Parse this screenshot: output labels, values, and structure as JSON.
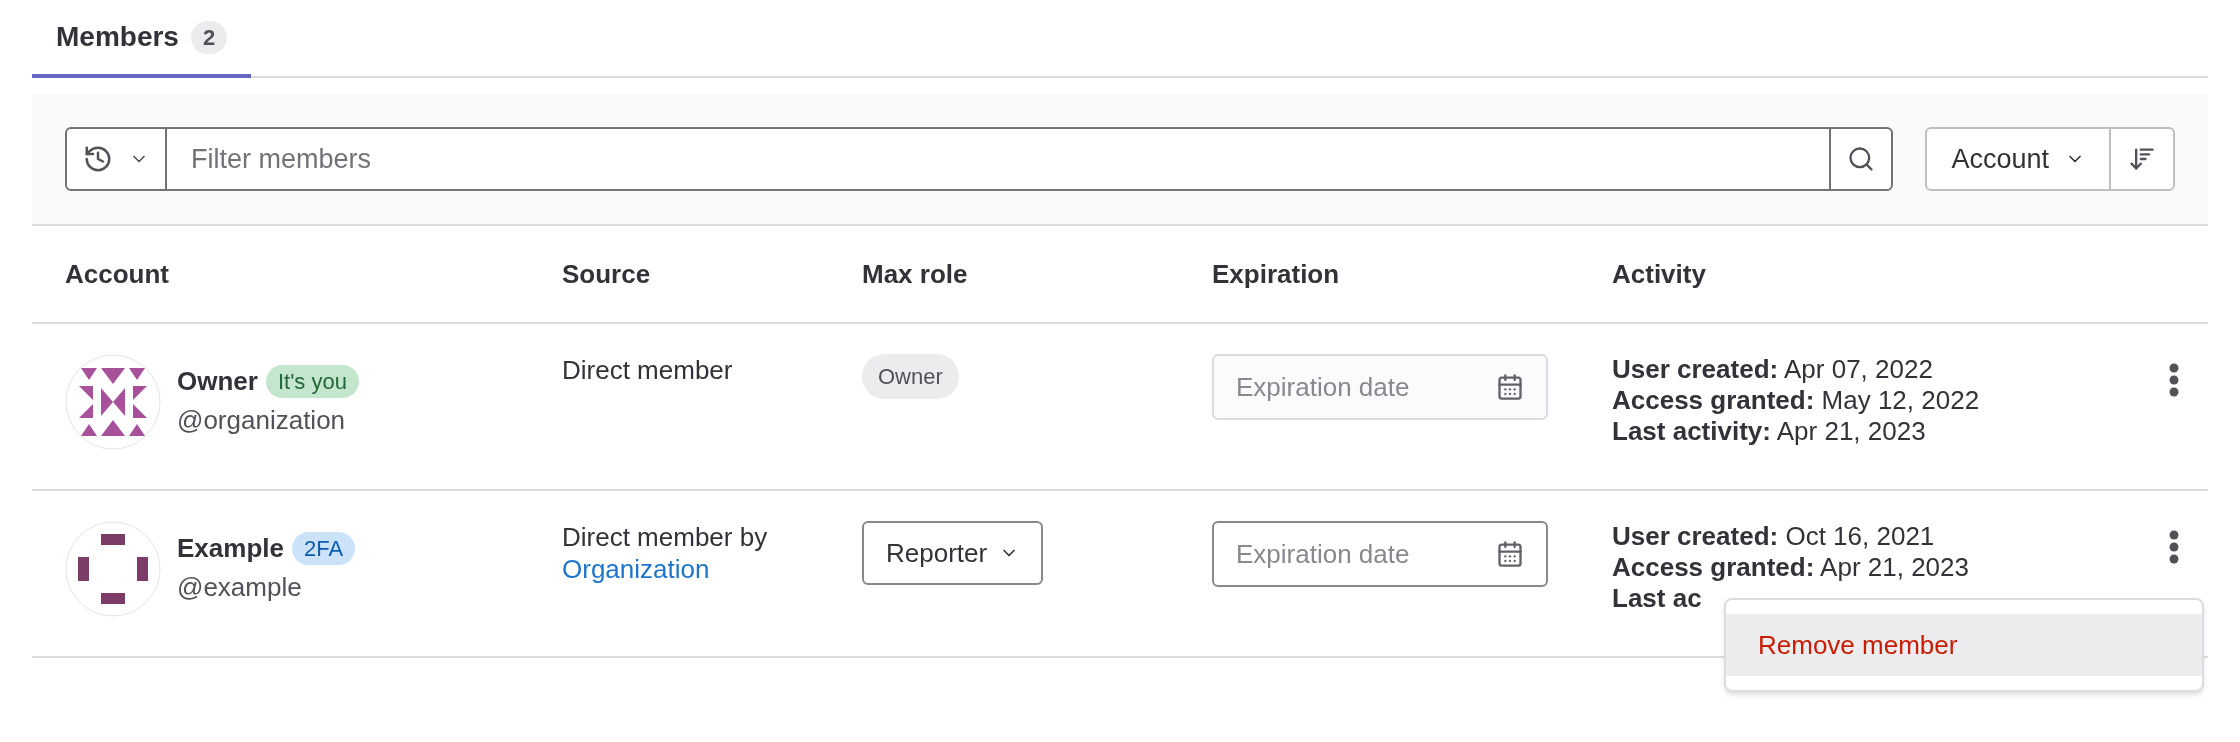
{
  "tabs": [
    {
      "label": "Members",
      "count": "2",
      "selected": true
    }
  ],
  "filter": {
    "placeholder": "Filter members"
  },
  "sort": {
    "label": "Account"
  },
  "table": {
    "columns": [
      "Account",
      "Source",
      "Max role",
      "Expiration",
      "Activity"
    ],
    "rows": [
      {
        "name": "Owner",
        "badge": {
          "text": "It's you",
          "kind": "success"
        },
        "username": "@organization",
        "avatar": {
          "kind": "quilt"
        },
        "source": "Direct member",
        "source_link": null,
        "role": {
          "kind": "badge",
          "text": "Owner"
        },
        "expiration": {
          "placeholder": "Expiration date",
          "disabled": true
        },
        "activity": [
          {
            "label": "User created:",
            "value": "Apr 07, 2022"
          },
          {
            "label": "Access granted:",
            "value": "May 12, 2022"
          },
          {
            "label": "Last activity:",
            "value": "Apr 21, 2023"
          }
        ],
        "menu_open": false
      },
      {
        "name": "Example",
        "badge": {
          "text": "2FA",
          "kind": "info"
        },
        "username": "@example",
        "avatar": {
          "kind": "frame"
        },
        "source": "Direct member by",
        "source_link": "Organization",
        "role": {
          "kind": "dropdown",
          "text": "Reporter"
        },
        "expiration": {
          "placeholder": "Expiration date",
          "disabled": false
        },
        "activity": [
          {
            "label": "User created:",
            "value": "Oct 16, 2021"
          },
          {
            "label": "Access granted:",
            "value": "Apr 21, 2023"
          },
          {
            "label": "Last ac"
          }
        ],
        "menu_open": true
      }
    ]
  },
  "menu": {
    "items": [
      {
        "label": "Remove member",
        "kind": "danger",
        "selected": true
      }
    ]
  }
}
